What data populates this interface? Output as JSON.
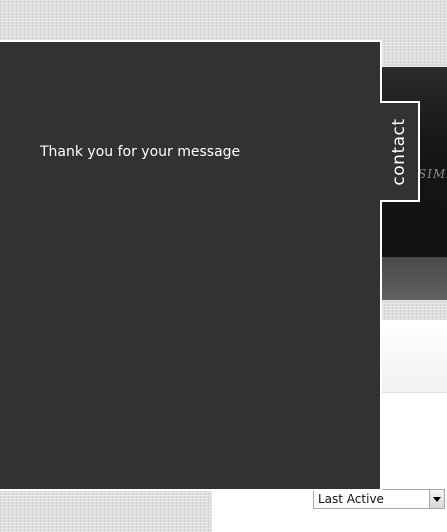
{
  "site": {
    "logo_text": "SIMM"
  },
  "contact": {
    "tab_label": "contact",
    "message": "Thank you for your message"
  },
  "sort_select": {
    "selected": "Last Active"
  }
}
